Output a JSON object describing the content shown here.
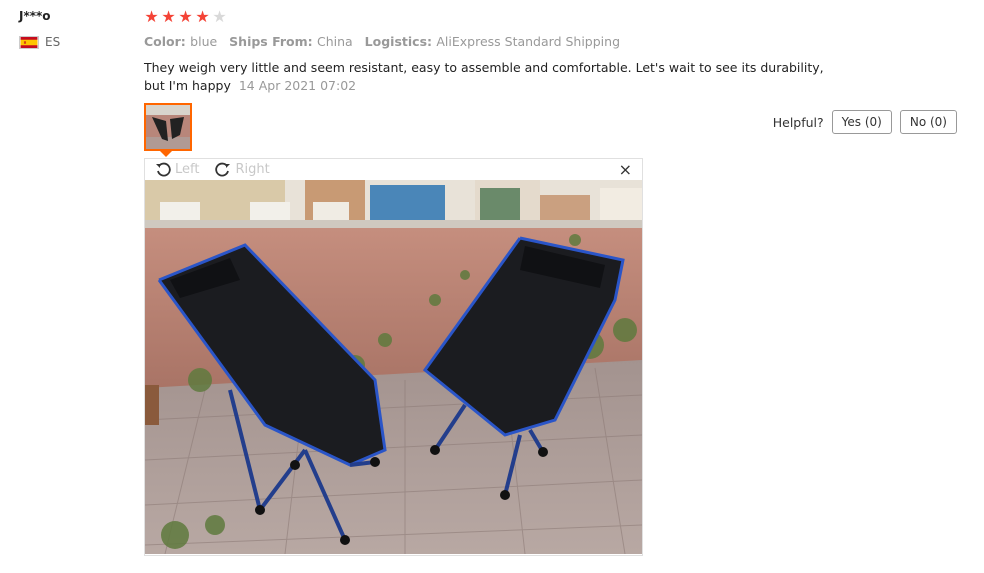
{
  "review": {
    "user": "J***o",
    "country": "ES",
    "rating": 4,
    "max_rating": 5,
    "attributes": [
      {
        "key": "Color:",
        "value": "blue"
      },
      {
        "key": "Ships From:",
        "value": "China"
      },
      {
        "key": "Logistics:",
        "value": "AliExpress Standard Shipping"
      }
    ],
    "text": "They weigh very little and seem resistant, easy to assemble and comfortable. Let's wait to see its durability, but I'm happy",
    "date": "14 Apr 2021 07:02"
  },
  "helpful": {
    "label": "Helpful?",
    "yes_label": "Yes (0)",
    "no_label": "No (0)"
  },
  "viewer": {
    "rotate_left_label": "Left",
    "rotate_right_label": "Right",
    "close_symbol": "×"
  },
  "colors": {
    "star_filled": "#f44336",
    "star_empty": "#d9d9d9",
    "accent": "#ff6600"
  }
}
